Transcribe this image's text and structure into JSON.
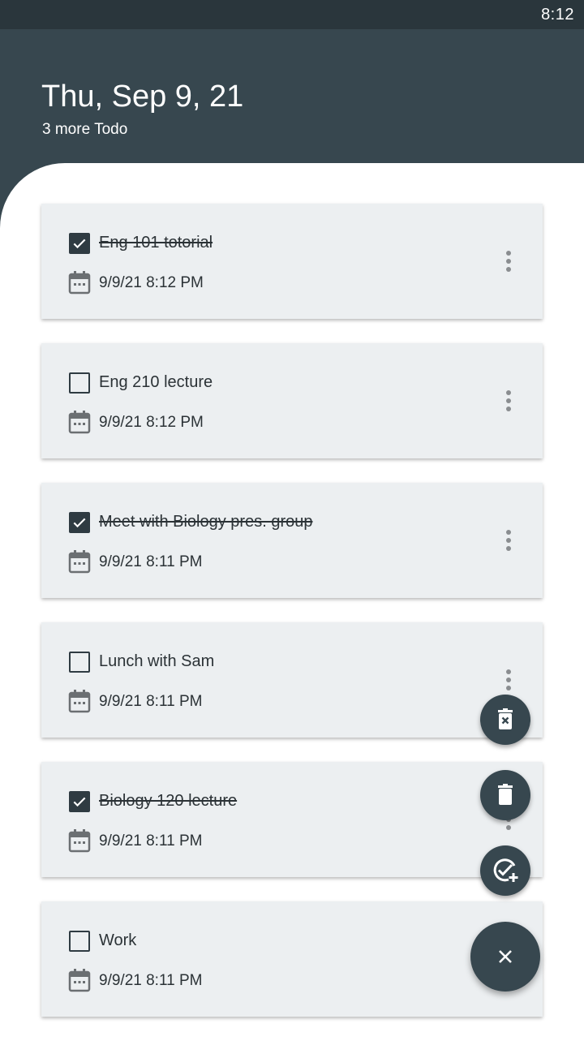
{
  "status_bar": {
    "time": "8:12"
  },
  "header": {
    "title": "Thu, Sep 9, 21",
    "subtitle": "3 more Todo"
  },
  "todos": [
    {
      "title": "Eng 101 totorial",
      "date": "9/9/21 8:12 PM",
      "checked": true
    },
    {
      "title": "Eng 210 lecture",
      "date": "9/9/21 8:12 PM",
      "checked": false
    },
    {
      "title": "Meet with Biology pres. group",
      "date": "9/9/21 8:11 PM",
      "checked": true
    },
    {
      "title": "Lunch with Sam",
      "date": "9/9/21 8:11 PM",
      "checked": false
    },
    {
      "title": "Biology 120 lecture",
      "date": "9/9/21 8:11 PM",
      "checked": true
    },
    {
      "title": "Work",
      "date": "9/9/21 8:11 PM",
      "checked": false
    }
  ],
  "icons": {
    "fab_actions": [
      "delete-checked-icon",
      "delete-all-icon",
      "add-todo-icon"
    ],
    "fab_main": "close-icon",
    "card": [
      "checkbox-icon",
      "calendar-icon",
      "more-vert-icon"
    ]
  },
  "colors": {
    "status_bar": "#2a363c",
    "header": "#37474f",
    "card": "#eceff1",
    "fab": "#37474f",
    "text": "#2b3236"
  }
}
